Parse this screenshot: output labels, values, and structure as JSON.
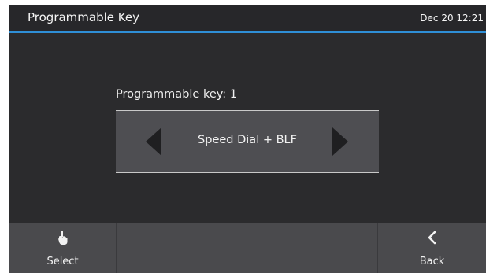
{
  "header": {
    "title": "Programmable Key",
    "clock": "Dec 20 12:21"
  },
  "main": {
    "field_label": "Programmable key: 1",
    "selected_value": "Speed Dial + BLF"
  },
  "softkeys": [
    {
      "label": "Select",
      "icon": "hand-pointer-icon"
    },
    {
      "label": "",
      "icon": ""
    },
    {
      "label": "",
      "icon": ""
    },
    {
      "label": "Back",
      "icon": "chevron-left-icon"
    }
  ],
  "colors": {
    "background": "#2b2b2d",
    "header_accent": "#2f8fd6",
    "selector_bg": "#4e4e52",
    "softkey_bar": "#4a4a4d"
  }
}
